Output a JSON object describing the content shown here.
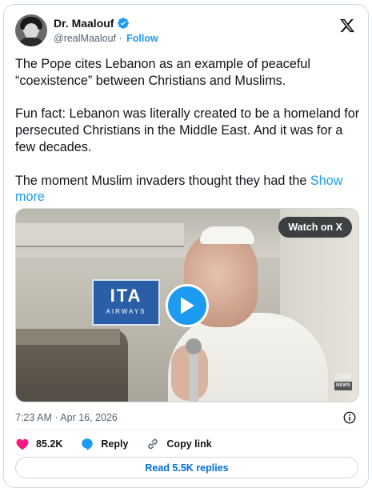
{
  "author": {
    "name": "Dr. Maalouf",
    "handle": "@realMaalouf",
    "separator": "·",
    "follow_label": "Follow",
    "verified_color": "#1d9bf0",
    "avatar_icon": "profile-photo"
  },
  "post": {
    "paragraphs": [
      "The Pope cites Lebanon as an example of peaceful “coexistence” between Christians and Muslims.",
      "Fun fact: Lebanon was literally created to be a homeland for persecuted Christians in the Middle East. And it was for a few decades.",
      "The moment Muslim invaders thought they had the "
    ],
    "show_more_label": "Show more"
  },
  "media": {
    "watch_label": "Watch on X",
    "sign_main": "ITA",
    "sign_sub": "AIRWAYS",
    "watermark_main": "DRM",
    "watermark_sub": "NEWS",
    "play_icon": "play-icon"
  },
  "meta": {
    "timestamp": "7:23 AM · Apr 16, 2026"
  },
  "actions": {
    "likes": "85.2K",
    "reply_label": "Reply",
    "copy_link_label": "Copy link"
  },
  "footer": {
    "read_replies_label": "Read 5.5K replies"
  },
  "colors": {
    "accent": "#1d9bf0",
    "like": "#f91880",
    "text": "#0f1419",
    "secondary": "#536471",
    "border": "#cfd9de"
  }
}
